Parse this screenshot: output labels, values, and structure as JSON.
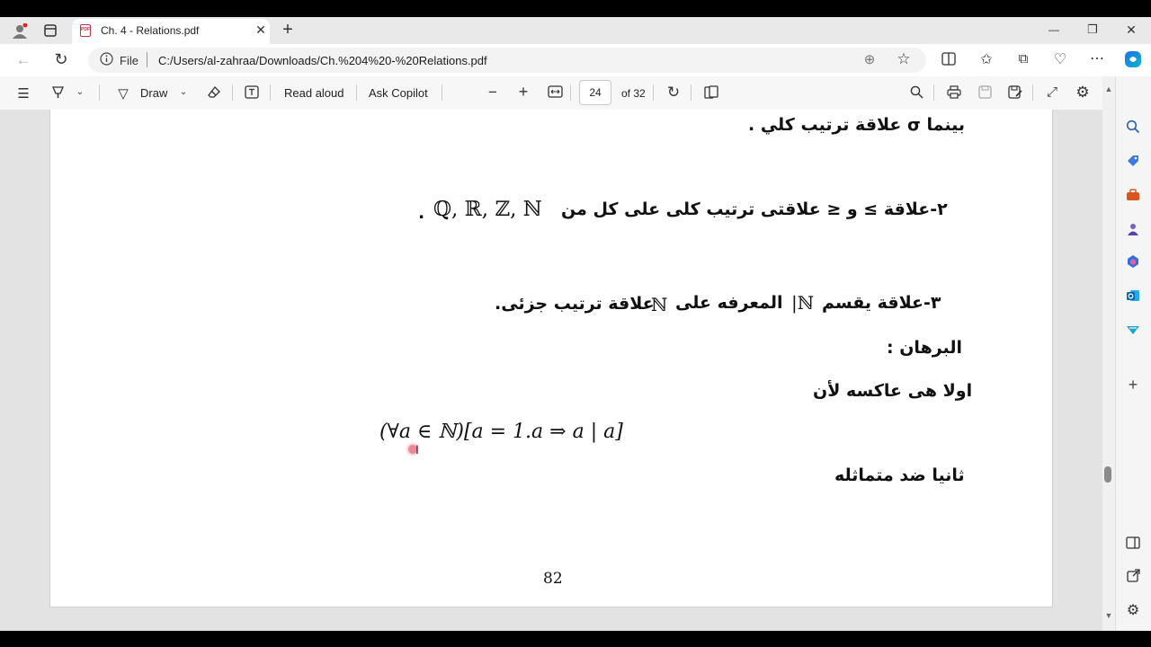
{
  "browser": {
    "tab_title": "Ch. 4 - Relations.pdf",
    "tab_close": "✕",
    "new_tab": "+",
    "address_scheme_label": "File",
    "address_url": "C:/Users/al-zahraa/Downloads/Ch.%204%20-%20Relations.pdf",
    "window_controls": {
      "minimize": "—",
      "restore": "❐",
      "close": "✕"
    }
  },
  "pdf_toolbar": {
    "draw_label": "Draw",
    "read_aloud_label": "Read aloud",
    "ask_copilot_label": "Ask Copilot",
    "zoom_out": "−",
    "zoom_in": "+",
    "page_current": "24",
    "page_total": "of 32"
  },
  "document": {
    "line1": "بينما σ علاقة ترتيب كلي .",
    "line2_prefix": "٢-علاقة ≥ و ≤ علاقتى ترتيب كلى على كل من",
    "line2_sets": "ℚ, ℝ, ℤ, ℕ",
    "line2_period": ".",
    "line3": "٣-علاقة يقسم",
    "line3_symbol": "|ℕ",
    "line3_rest": "المعرفه على",
    "line3_set": "ℕ",
    "line3_end": "علاقة ترتيب جزئى.",
    "proof_heading": "البرهان :",
    "reflexive_line": "اولا هى عاكسه لأن",
    "formula": "(∀a ∈ ℕ)[a = 1.a ⇒ a | a]",
    "antisymmetric_line": "ثانيا ضد متماثله",
    "page_number": "82"
  },
  "colors": {
    "accent_copilot": "#1a73e8",
    "pdf_icon": "#c4314b",
    "cursor_highlight": "#dc2846"
  }
}
